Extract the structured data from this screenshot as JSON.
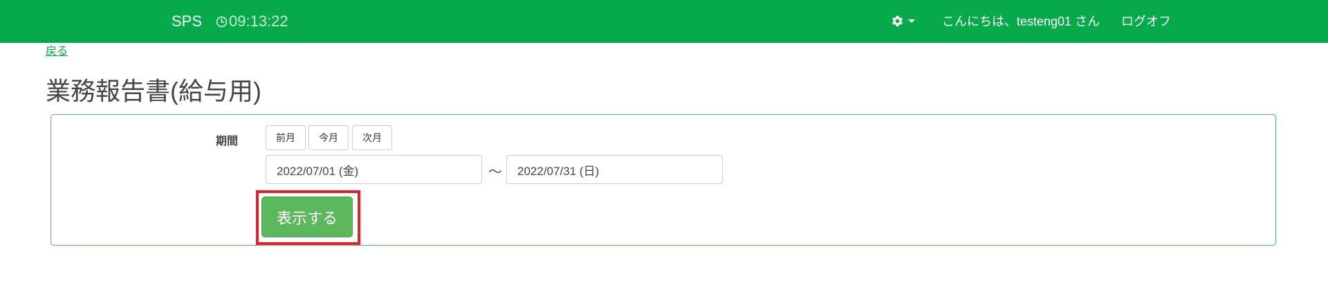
{
  "header": {
    "brand": "SPS",
    "clock_time": "09:13:22",
    "greeting": "こんにちは、testeng01 さん",
    "logoff_label": "ログオフ"
  },
  "nav": {
    "back_label": "戻る"
  },
  "page": {
    "title": "業務報告書(給与用)"
  },
  "form": {
    "period_label": "期間",
    "prev_month_label": "前月",
    "this_month_label": "今月",
    "next_month_label": "次月",
    "start_date": "2022/07/01 (金)",
    "separator": "～",
    "end_date": "2022/07/31 (日)",
    "submit_label": "表示する"
  },
  "colors": {
    "header_bg": "#07aa4b",
    "submit_bg": "#5cb85c",
    "highlight_border": "#e41e2b"
  },
  "icons": {
    "clock": "clock-icon",
    "settings": "gear-icon",
    "dropdown": "caret-down-icon"
  }
}
